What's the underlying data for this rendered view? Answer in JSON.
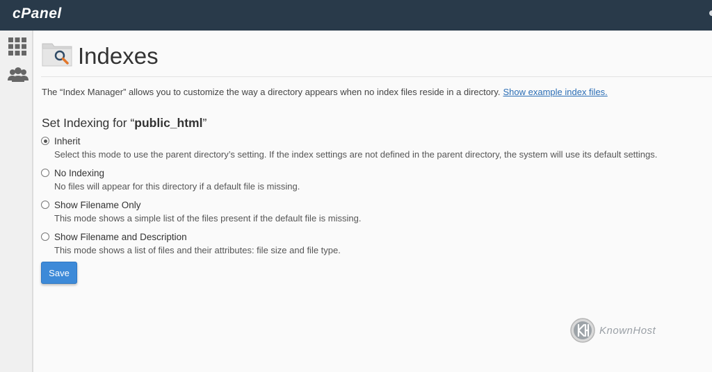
{
  "app": {
    "logo_text": "cPanel"
  },
  "sidebar": {
    "items": [
      {
        "icon": "grid-icon"
      },
      {
        "icon": "users-icon"
      }
    ]
  },
  "page": {
    "title": "Indexes",
    "title_icon": "folder-search-icon",
    "description": "The “Index Manager” allows you to customize the way a directory appears when no index files reside in a directory.",
    "description_link": "Show example index files.",
    "heading_prefix": "Set Indexing for “",
    "heading_dir": "public_html",
    "heading_suffix": "”"
  },
  "options": [
    {
      "label": "Inherit",
      "help": "Select this mode to use the parent directory’s setting. If the index settings are not defined in the parent directory, the system will use its default settings.",
      "checked": true
    },
    {
      "label": "No Indexing",
      "help": "No files will appear for this directory if a default file is missing.",
      "checked": false
    },
    {
      "label": "Show Filename Only",
      "help": "This mode shows a simple list of the files present if the default file is missing.",
      "checked": false
    },
    {
      "label": "Show Filename and Description",
      "help": "This mode shows a list of files and their attributes: file size and file type.",
      "checked": false
    }
  ],
  "actions": {
    "save_label": "Save"
  },
  "watermark": {
    "text": "KnownHost"
  },
  "colors": {
    "topbar": "#293a4a",
    "accent": "#3d8ad8",
    "link": "#2a6db5"
  }
}
